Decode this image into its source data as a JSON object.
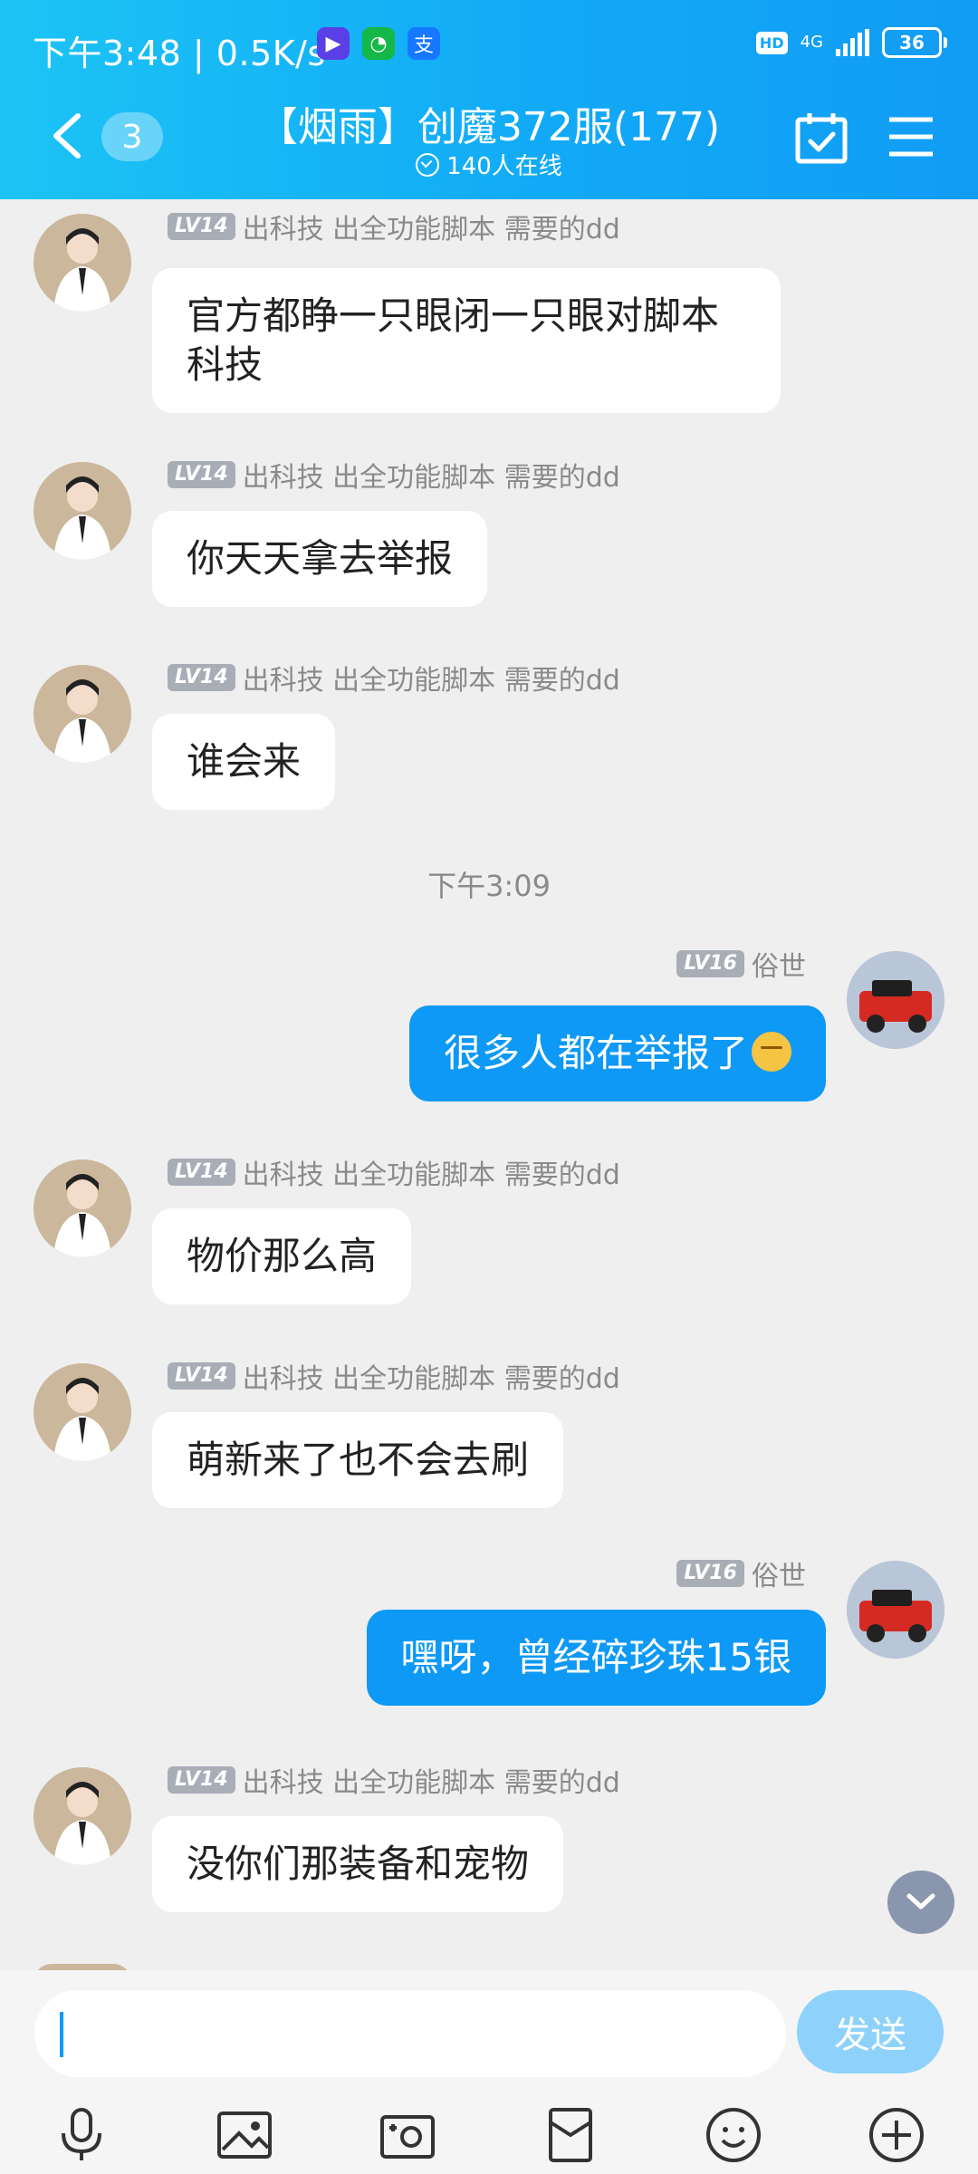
{
  "status_bar": {
    "time_speed": "下午3:48 | 0.5K/s",
    "network": "4G",
    "hd": "HD",
    "battery": "36"
  },
  "header": {
    "back_count": "3",
    "title": "【烟雨】创魔372服(177)",
    "online": "140人在线"
  },
  "messages": [
    {
      "side": "left",
      "level": "LV14",
      "sender": "出科技 出全功能脚本 需要的dd",
      "text": "官方都睁一只眼闭一只眼对脚本科技"
    },
    {
      "side": "left",
      "level": "LV14",
      "sender": "出科技 出全功能脚本 需要的dd",
      "text": "你天天拿去举报"
    },
    {
      "side": "left",
      "level": "LV14",
      "sender": "出科技 出全功能脚本 需要的dd",
      "text": "谁会来"
    },
    {
      "timestamp": "下午3:09"
    },
    {
      "side": "right",
      "level": "LV16",
      "sender": "俗世",
      "text": "很多人都在举报了"
    },
    {
      "side": "left",
      "level": "LV14",
      "sender": "出科技 出全功能脚本 需要的dd",
      "text": "物价那么高"
    },
    {
      "side": "left",
      "level": "LV14",
      "sender": "出科技 出全功能脚本 需要的dd",
      "text": "萌新来了也不会去刷"
    },
    {
      "side": "right",
      "level": "LV16",
      "sender": "俗世",
      "text": "嘿呀，曾经碎珍珠15银"
    },
    {
      "side": "left",
      "level": "LV14",
      "sender": "出科技 出全功能脚本 需要的dd",
      "text": "没你们那装备和宠物"
    }
  ],
  "input": {
    "value": "",
    "send_label": "发送"
  },
  "toolbar_icons": [
    "microphone-icon",
    "image-icon",
    "camera-icon",
    "red-packet-icon",
    "emoji-icon",
    "plus-icon"
  ]
}
